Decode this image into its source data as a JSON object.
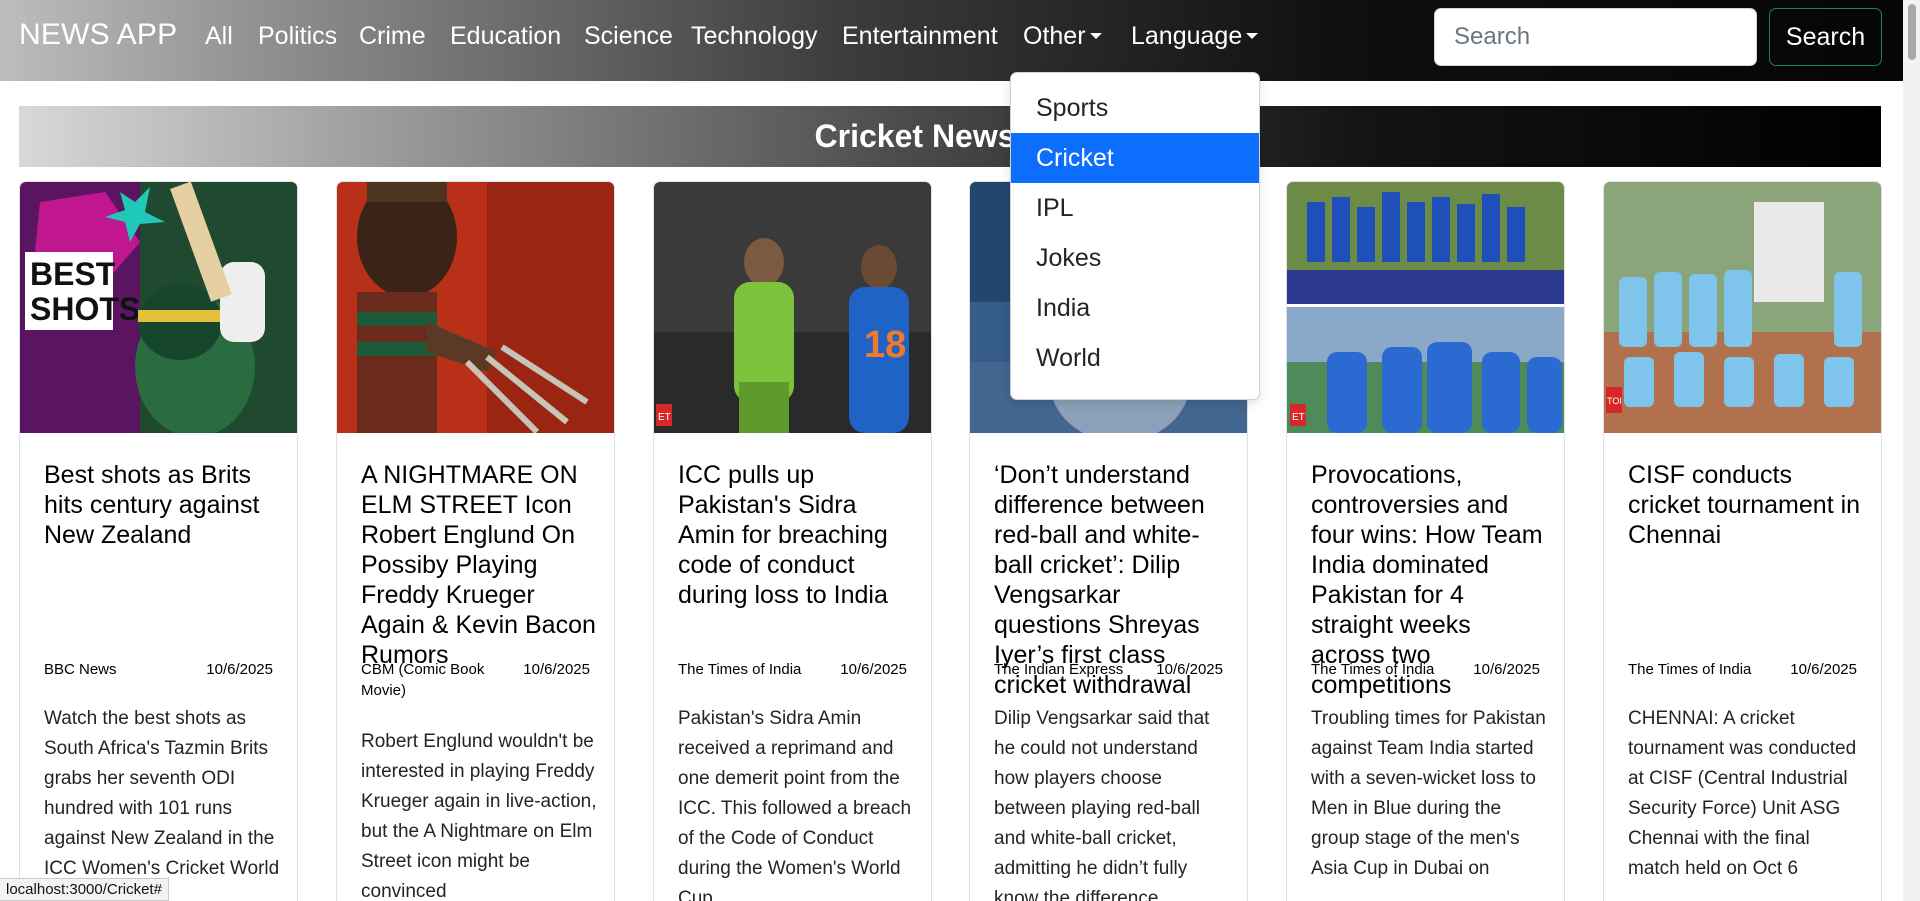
{
  "navbar": {
    "brand": "NEWS APP",
    "links": [
      "All",
      "Politics",
      "Crime",
      "Education",
      "Science",
      "Technology",
      "Entertainment"
    ],
    "other_label": "Other",
    "language_label": "Language",
    "search_placeholder": "Search",
    "search_button": "Search"
  },
  "banner": {
    "title": "Cricket News App"
  },
  "dropdown": {
    "items": [
      "Sports",
      "Cricket",
      "IPL",
      "Jokes",
      "India",
      "World"
    ],
    "active": "Cricket"
  },
  "cards": [
    {
      "title": "Best shots as Brits hits century against New Zealand",
      "source": "BBC News",
      "date": "10/6/2025",
      "text": "Watch the best shots as South Africa's Tazmin Brits grabs her seventh ODI hundred with 101 runs against New Zealand in the ICC Women's Cricket World Cup."
    },
    {
      "title": "A NIGHTMARE ON ELM STREET Icon Robert Englund On Possiby Playing Freddy Krueger Again & Kevin Bacon Rumors",
      "source": "CBM (Comic Book Movie)",
      "date": "10/6/2025",
      "text": "Robert Englund wouldn't be interested in playing Freddy Krueger again in live-action, but the A Nightmare on Elm Street icon might be convinced"
    },
    {
      "title": "ICC pulls up Pakistan's Sidra Amin for breaching code of conduct during loss to India",
      "source": "The Times of India",
      "date": "10/6/2025",
      "text": "Pakistan's Sidra Amin received a reprimand and one demerit point from the ICC. This followed a breach of the Code of Conduct during the Women's World Cup"
    },
    {
      "title": "‘Don’t understand difference between red-ball and white-ball cricket’: Dilip Vengsarkar questions Shreyas Iyer’s first class cricket withdrawal",
      "source": "The Indian Express",
      "date": "10/6/2025",
      "text": "Dilip Vengsarkar said that he could not understand how players choose between playing red-ball and white-ball cricket, admitting he didn’t fully know the difference"
    },
    {
      "title": "Provocations, controversies and four wins: How Team India dominated Pakistan for 4 straight weeks across two competitions",
      "source": "The Times of India",
      "date": "10/6/2025",
      "text": "Troubling times for Pakistan against Team India started with a seven-wicket loss to Men in Blue during the group stage of the men's Asia Cup in Dubai on"
    },
    {
      "title": "CISF conducts cricket tournament in Chennai",
      "source": "The Times of India",
      "date": "10/6/2025",
      "text": "CHENNAI: A cricket tournament was conducted at CISF (Central Industrial Security Force) Unit ASG Chennai with the final match held on Oct 6"
    }
  ],
  "image_badges": {
    "best_shots": "BEST\nSHOTS",
    "et": "ET",
    "toi": "TOI",
    "jersey": "18"
  },
  "status_bar": "localhost:3000/Cricket#"
}
